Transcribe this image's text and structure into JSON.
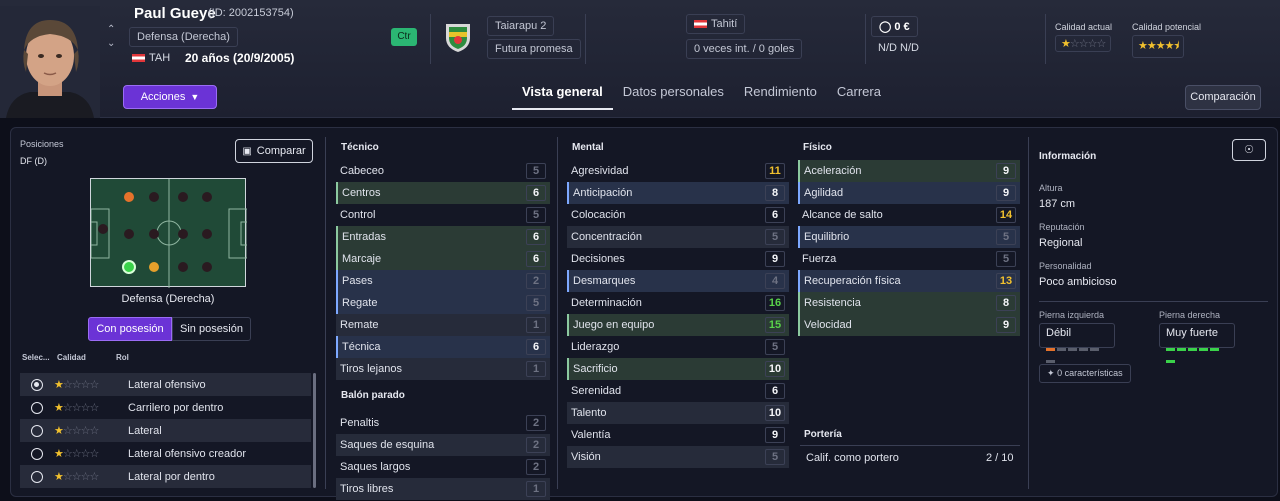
{
  "header": {
    "name": "Paul Gueye",
    "id_text": "(ID: 2002153754)",
    "position": "Defensa (Derecha)",
    "nation_code": "TAH",
    "age": "20 años (20/9/2005)",
    "badge": "Ctr",
    "club": "Taiarapu 2",
    "status": "Futura promesa",
    "nation": "Tahití",
    "caps": "0 veces int. / 0 goles",
    "value": "0 €",
    "na1": "N/D",
    "na2": "N/D",
    "current_label": "Calidad actual",
    "potential_label": "Calidad potencial",
    "current_stars": 1,
    "potential_stars": 4.5
  },
  "actions_label": "Acciones",
  "compare_top_label": "Comparación",
  "tabs": [
    "Vista general",
    "Datos personales",
    "Rendimiento",
    "Carrera"
  ],
  "left": {
    "positions_label": "Posiciones",
    "pos_code": "DF (D)",
    "compare_label": "Comparar",
    "pitch_caption": "Defensa (Derecha)",
    "with_ball": "Con posesión",
    "without_ball": "Sin posesión",
    "cols": [
      "Selec...",
      "Calidad",
      "Rol"
    ],
    "roles": [
      {
        "name": "Lateral ofensivo",
        "stars": 1,
        "selected": true
      },
      {
        "name": "Carrilero por dentro",
        "stars": 1,
        "selected": false
      },
      {
        "name": "Lateral",
        "stars": 1,
        "selected": false
      },
      {
        "name": "Lateral ofensivo creador",
        "stars": 1,
        "selected": false
      },
      {
        "name": "Lateral por dentro",
        "stars": 1,
        "selected": false
      }
    ]
  },
  "tecnico": {
    "title": "Técnico",
    "attrs": [
      {
        "name": "Cabeceo",
        "value": "5",
        "hl": ""
      },
      {
        "name": "Centros",
        "value": "6",
        "hl": "g"
      },
      {
        "name": "Control",
        "value": "5",
        "hl": ""
      },
      {
        "name": "Entradas",
        "value": "6",
        "hl": "g"
      },
      {
        "name": "Marcaje",
        "value": "6",
        "hl": "g"
      },
      {
        "name": "Pases",
        "value": "2",
        "hl": "b"
      },
      {
        "name": "Regate",
        "value": "5",
        "hl": "b"
      },
      {
        "name": "Remate",
        "value": "1",
        "hl": ""
      },
      {
        "name": "Técnica",
        "value": "6",
        "hl": "b"
      },
      {
        "name": "Tiros lejanos",
        "value": "1",
        "hl": ""
      }
    ]
  },
  "balon": {
    "title": "Balón parado",
    "attrs": [
      {
        "name": "Penaltis",
        "value": "2",
        "hl": ""
      },
      {
        "name": "Saques de esquina",
        "value": "2",
        "hl": ""
      },
      {
        "name": "Saques largos",
        "value": "2",
        "hl": ""
      },
      {
        "name": "Tiros libres",
        "value": "1",
        "hl": ""
      }
    ]
  },
  "mental": {
    "title": "Mental",
    "attrs": [
      {
        "name": "Agresividad",
        "value": "11",
        "hl": ""
      },
      {
        "name": "Anticipación",
        "value": "8",
        "hl": "b"
      },
      {
        "name": "Colocación",
        "value": "6",
        "hl": ""
      },
      {
        "name": "Concentración",
        "value": "5",
        "hl": ""
      },
      {
        "name": "Decisiones",
        "value": "9",
        "hl": ""
      },
      {
        "name": "Desmarques",
        "value": "4",
        "hl": "b"
      },
      {
        "name": "Determinación",
        "value": "16",
        "hl": ""
      },
      {
        "name": "Juego en equipo",
        "value": "15",
        "hl": "g"
      },
      {
        "name": "Liderazgo",
        "value": "5",
        "hl": ""
      },
      {
        "name": "Sacrificio",
        "value": "10",
        "hl": "g"
      },
      {
        "name": "Serenidad",
        "value": "6",
        "hl": ""
      },
      {
        "name": "Talento",
        "value": "10",
        "hl": ""
      },
      {
        "name": "Valentía",
        "value": "9",
        "hl": ""
      },
      {
        "name": "Visión",
        "value": "5",
        "hl": ""
      }
    ]
  },
  "fisico": {
    "title": "Físico",
    "attrs": [
      {
        "name": "Aceleración",
        "value": "9",
        "hl": "g"
      },
      {
        "name": "Agilidad",
        "value": "9",
        "hl": "b"
      },
      {
        "name": "Alcance de salto",
        "value": "14",
        "hl": ""
      },
      {
        "name": "Equilibrio",
        "value": "5",
        "hl": "b"
      },
      {
        "name": "Fuerza",
        "value": "5",
        "hl": ""
      },
      {
        "name": "Recuperación física",
        "value": "13",
        "hl": "b"
      },
      {
        "name": "Resistencia",
        "value": "8",
        "hl": "g"
      },
      {
        "name": "Velocidad",
        "value": "9",
        "hl": "g"
      }
    ]
  },
  "porteria": {
    "title": "Portería",
    "label": "Calif. como portero",
    "value": "2 / 10"
  },
  "info": {
    "title": "Información",
    "height_label": "Altura",
    "height": "187 cm",
    "rep_label": "Reputación",
    "rep": "Regional",
    "pers_label": "Personalidad",
    "pers": "Poco ambicioso",
    "left_foot_label": "Pierna izquierda",
    "left_foot": "Débil",
    "right_foot_label": "Pierna derecha",
    "right_foot": "Muy fuerte",
    "traits": "0 características"
  },
  "colors": {
    "accent": "#6b33d6",
    "yellow": "#f2c12e",
    "green": "#3ad24a",
    "orange": "#e5722b"
  }
}
